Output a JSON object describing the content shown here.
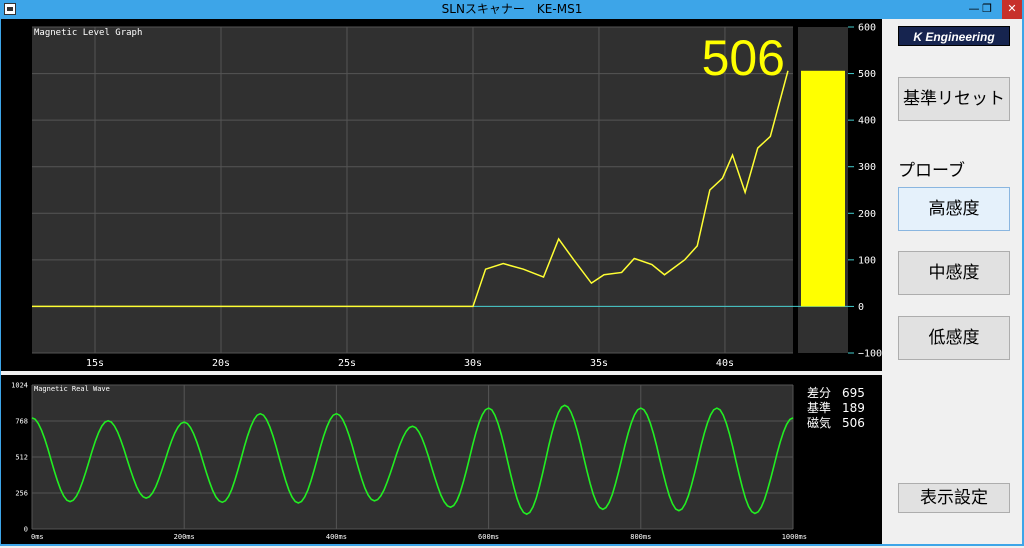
{
  "window": {
    "title": "SLNスキャナー　KE-MS1",
    "min_glyph": "—",
    "max_glyph": "❐",
    "close_glyph": "✕"
  },
  "level_graph": {
    "label": "Magnetic Level Graph",
    "current_value": "506",
    "colors": {
      "trace": "#ffff33",
      "baseline": "#44cccc",
      "bar": "#ffff00",
      "grid": "#555555",
      "background": "#303030"
    }
  },
  "wave_graph": {
    "label": "Magnetic Real Wave",
    "colors": {
      "trace": "#22ee22",
      "background": "#303030",
      "grid": "#555555"
    }
  },
  "readout": [
    {
      "label": "差分",
      "value": "695"
    },
    {
      "label": "基準",
      "value": "189"
    },
    {
      "label": "磁気",
      "value": "506"
    }
  ],
  "sidebar": {
    "logo_text": "K Engineering",
    "reset_button": "基準リセット",
    "probe_label": "プローブ",
    "probe_options": [
      "高感度",
      "中感度",
      "低感度"
    ],
    "probe_selected": "高感度",
    "display_settings_button": "表示設定"
  },
  "chart_data": [
    {
      "type": "line",
      "title": "Magnetic Level Graph",
      "xlabel": "",
      "ylabel": "",
      "x_ticks": [
        "15s",
        "20s",
        "25s",
        "30s",
        "35s",
        "40s"
      ],
      "y_ticks": [
        "600",
        "500",
        "400",
        "300",
        "200",
        "100",
        "0",
        "−100"
      ],
      "xlim": [
        12.5,
        42.7
      ],
      "ylim": [
        -100,
        600
      ],
      "grid": true,
      "series": [
        {
          "x": [
            12.5,
            30.0,
            30.5,
            31.2,
            32.0,
            32.8,
            33.4,
            34.0,
            34.7,
            35.2,
            35.9,
            36.4,
            37.1,
            37.6,
            38.4,
            38.9,
            39.4,
            39.9,
            40.3,
            40.8,
            41.3,
            41.8,
            42.5
          ],
          "y": [
            0,
            0,
            80,
            92,
            80,
            63,
            145,
            100,
            50,
            68,
            73,
            103,
            90,
            68,
            100,
            130,
            250,
            275,
            325,
            245,
            340,
            365,
            506
          ]
        }
      ],
      "bar": {
        "value": 506
      }
    },
    {
      "type": "line",
      "title": "Magnetic Real Wave",
      "xlabel": "",
      "ylabel": "",
      "x_ticks": [
        "0ms",
        "200ms",
        "400ms",
        "600ms",
        "800ms",
        "1000ms"
      ],
      "y_ticks": [
        "1024",
        "768",
        "512",
        "256",
        "0"
      ],
      "xlim": [
        0,
        1000
      ],
      "ylim": [
        0,
        1024
      ],
      "grid": true,
      "series": [
        {
          "x": [
            0,
            50,
            100,
            150,
            200,
            250,
            300,
            350,
            400,
            450,
            500,
            550,
            600,
            650,
            700,
            750,
            800,
            850,
            900,
            950,
            1000
          ],
          "y": [
            790,
            195,
            770,
            220,
            760,
            190,
            820,
            185,
            820,
            200,
            730,
            155,
            860,
            105,
            880,
            140,
            860,
            130,
            860,
            110,
            790
          ]
        }
      ]
    }
  ]
}
